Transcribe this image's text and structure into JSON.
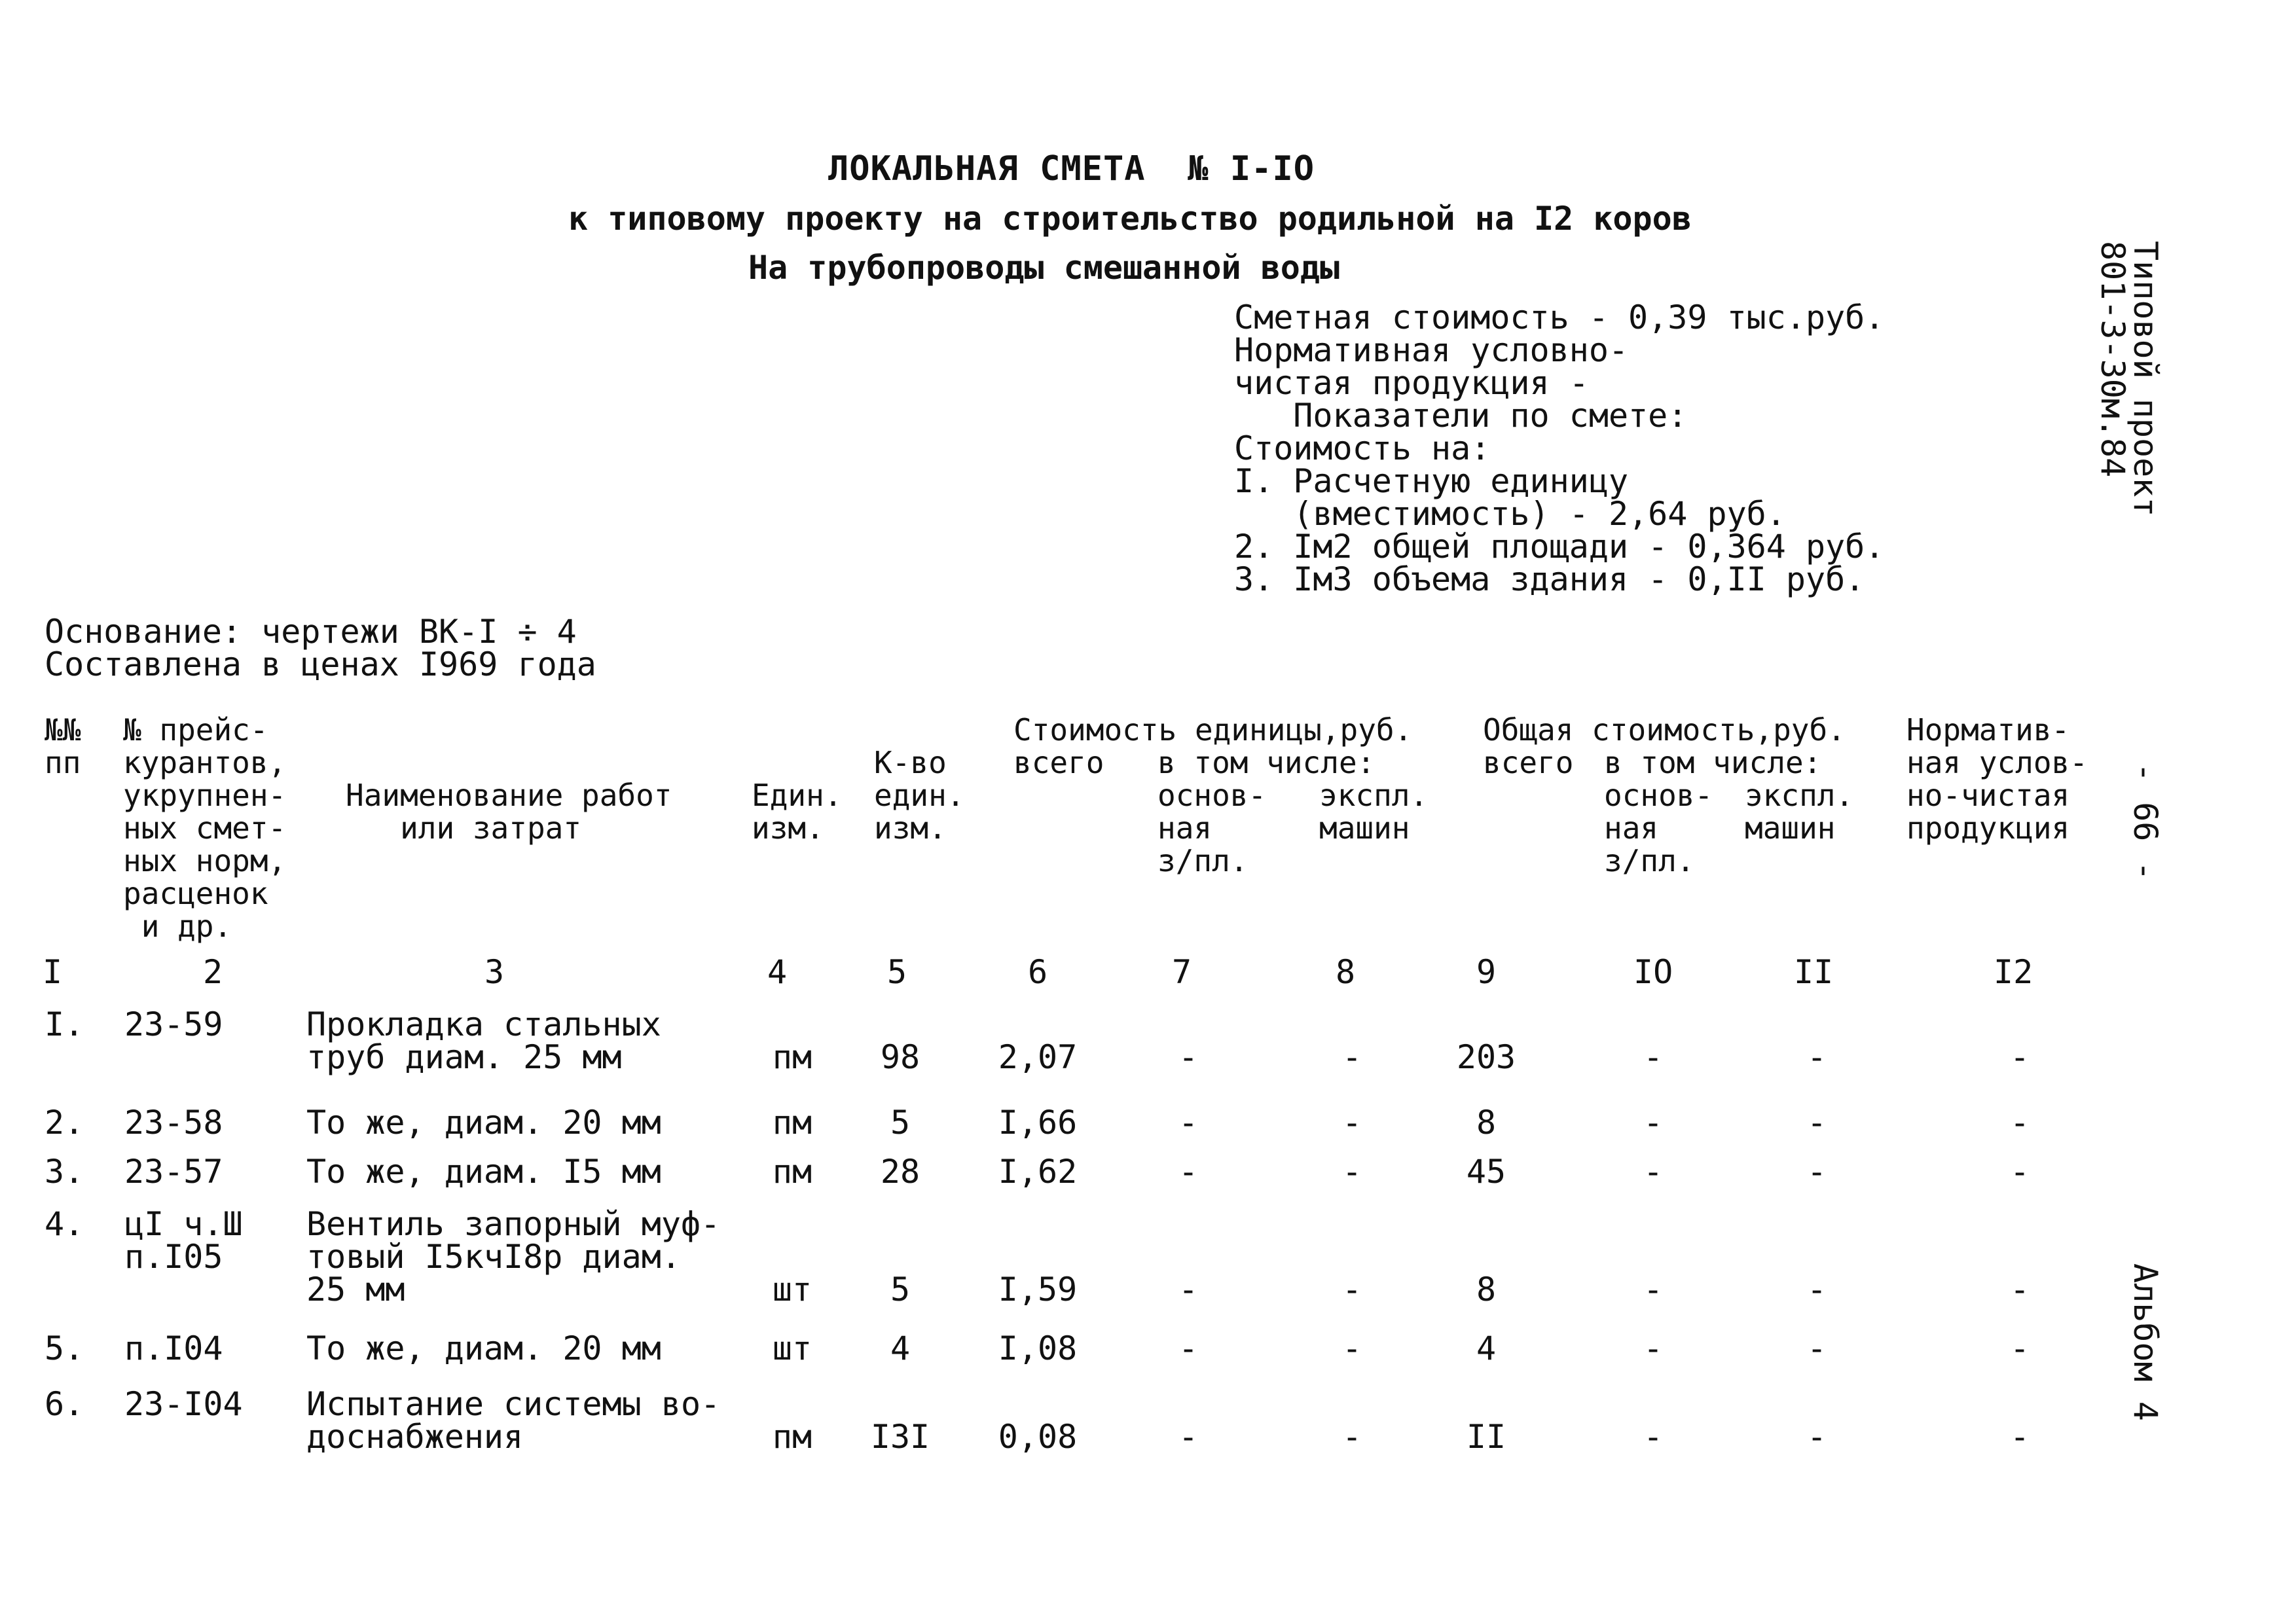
{
  "header": {
    "title": "ЛОКАЛЬНАЯ СМЕТА  № I-IO",
    "subtitle": "к типовому проекту на строительство родильной на I2 коров",
    "object": "На трубопроводы смешанной воды"
  },
  "summary": {
    "lines": [
      "Сметная стоимость - 0,39 тыс.руб.",
      "Нормативная условно-",
      "чистая продукция -",
      "   Показатели по смете:",
      "Стоимость на:",
      "I. Расчетную единицу",
      "   (вместимость) - 2,64 руб.",
      "2. Iм2 общей площади - 0,364 руб.",
      "3. Iм3 объема здания - 0,II руб."
    ]
  },
  "margin": {
    "project_label": "Типовой проект",
    "project_code": "801-3-30м.84",
    "page_number": "- 66 -",
    "album": "Альбом 4"
  },
  "basis": {
    "line1": "Основание: чертежи ВК-I ÷ 4",
    "line2": "Составлена в ценах I969 года"
  },
  "table": {
    "headers": {
      "c1": "№№\nпп",
      "c2": "№ прейс-\nкурантов,\nукрупнен-\nных смет-\nных норм,\nрасценок\n и др.",
      "c3": "Наименование работ\n   или затрат",
      "c4": "Един.\nизм.",
      "c5": "К-во\nедин.\nизм.",
      "unit_cost_group": "Стоимость единицы,руб.",
      "c6": "всего",
      "incl1": "в том числе:",
      "c7": "основ-\nная\nз/пл.",
      "c8": "экспл.\nмашин",
      "total_group": "Общая стоимость,руб.",
      "c9": "всего",
      "incl2": "в том числе:",
      "c10": "основ-\nная\nз/пл.",
      "c11": "экспл.\nмашин",
      "c12": "Норматив-\nная услов-\nно-чистая\nпродукция"
    },
    "column_numbers": [
      "I",
      "2",
      "3",
      "4",
      "5",
      "6",
      "7",
      "8",
      "9",
      "IO",
      "II",
      "I2"
    ],
    "rows": [
      {
        "n": "I.",
        "code": "23-59",
        "name": "Прокладка стальных\nтруб диам. 25 мм",
        "unit": "пм",
        "qty": "98",
        "unit_total": "2,07",
        "unit_wage": "-",
        "unit_mach": "-",
        "total": "203",
        "total_wage": "-",
        "total_mach": "-",
        "npp": "-"
      },
      {
        "n": "2.",
        "code": "23-58",
        "name": "То же, диам. 20 мм",
        "unit": "пм",
        "qty": "5",
        "unit_total": "I,66",
        "unit_wage": "-",
        "unit_mach": "-",
        "total": "8",
        "total_wage": "-",
        "total_mach": "-",
        "npp": "-"
      },
      {
        "n": "3.",
        "code": "23-57",
        "name": "То же, диам. I5 мм",
        "unit": "пм",
        "qty": "28",
        "unit_total": "I,62",
        "unit_wage": "-",
        "unit_mach": "-",
        "total": "45",
        "total_wage": "-",
        "total_mach": "-",
        "npp": "-"
      },
      {
        "n": "4.",
        "code": "цI ч.Ш\nп.I05",
        "name": "Вентиль запорный муф-\nтовый I5кчI8р диам.\n25 мм",
        "unit": "шт",
        "qty": "5",
        "unit_total": "I,59",
        "unit_wage": "-",
        "unit_mach": "-",
        "total": "8",
        "total_wage": "-",
        "total_mach": "-",
        "npp": "-"
      },
      {
        "n": "5.",
        "code": "п.I04",
        "name": "То же, диам. 20 мм",
        "unit": "шт",
        "qty": "4",
        "unit_total": "I,08",
        "unit_wage": "-",
        "unit_mach": "-",
        "total": "4",
        "total_wage": "-",
        "total_mach": "-",
        "npp": "-"
      },
      {
        "n": "6.",
        "code": "23-I04",
        "name": "Испытание системы во-\nдоснабжения",
        "unit": "пм",
        "qty": "I3I",
        "unit_total": "0,08",
        "unit_wage": "-",
        "unit_mach": "-",
        "total": "II",
        "total_wage": "-",
        "total_mach": "-",
        "npp": "-"
      }
    ]
  }
}
